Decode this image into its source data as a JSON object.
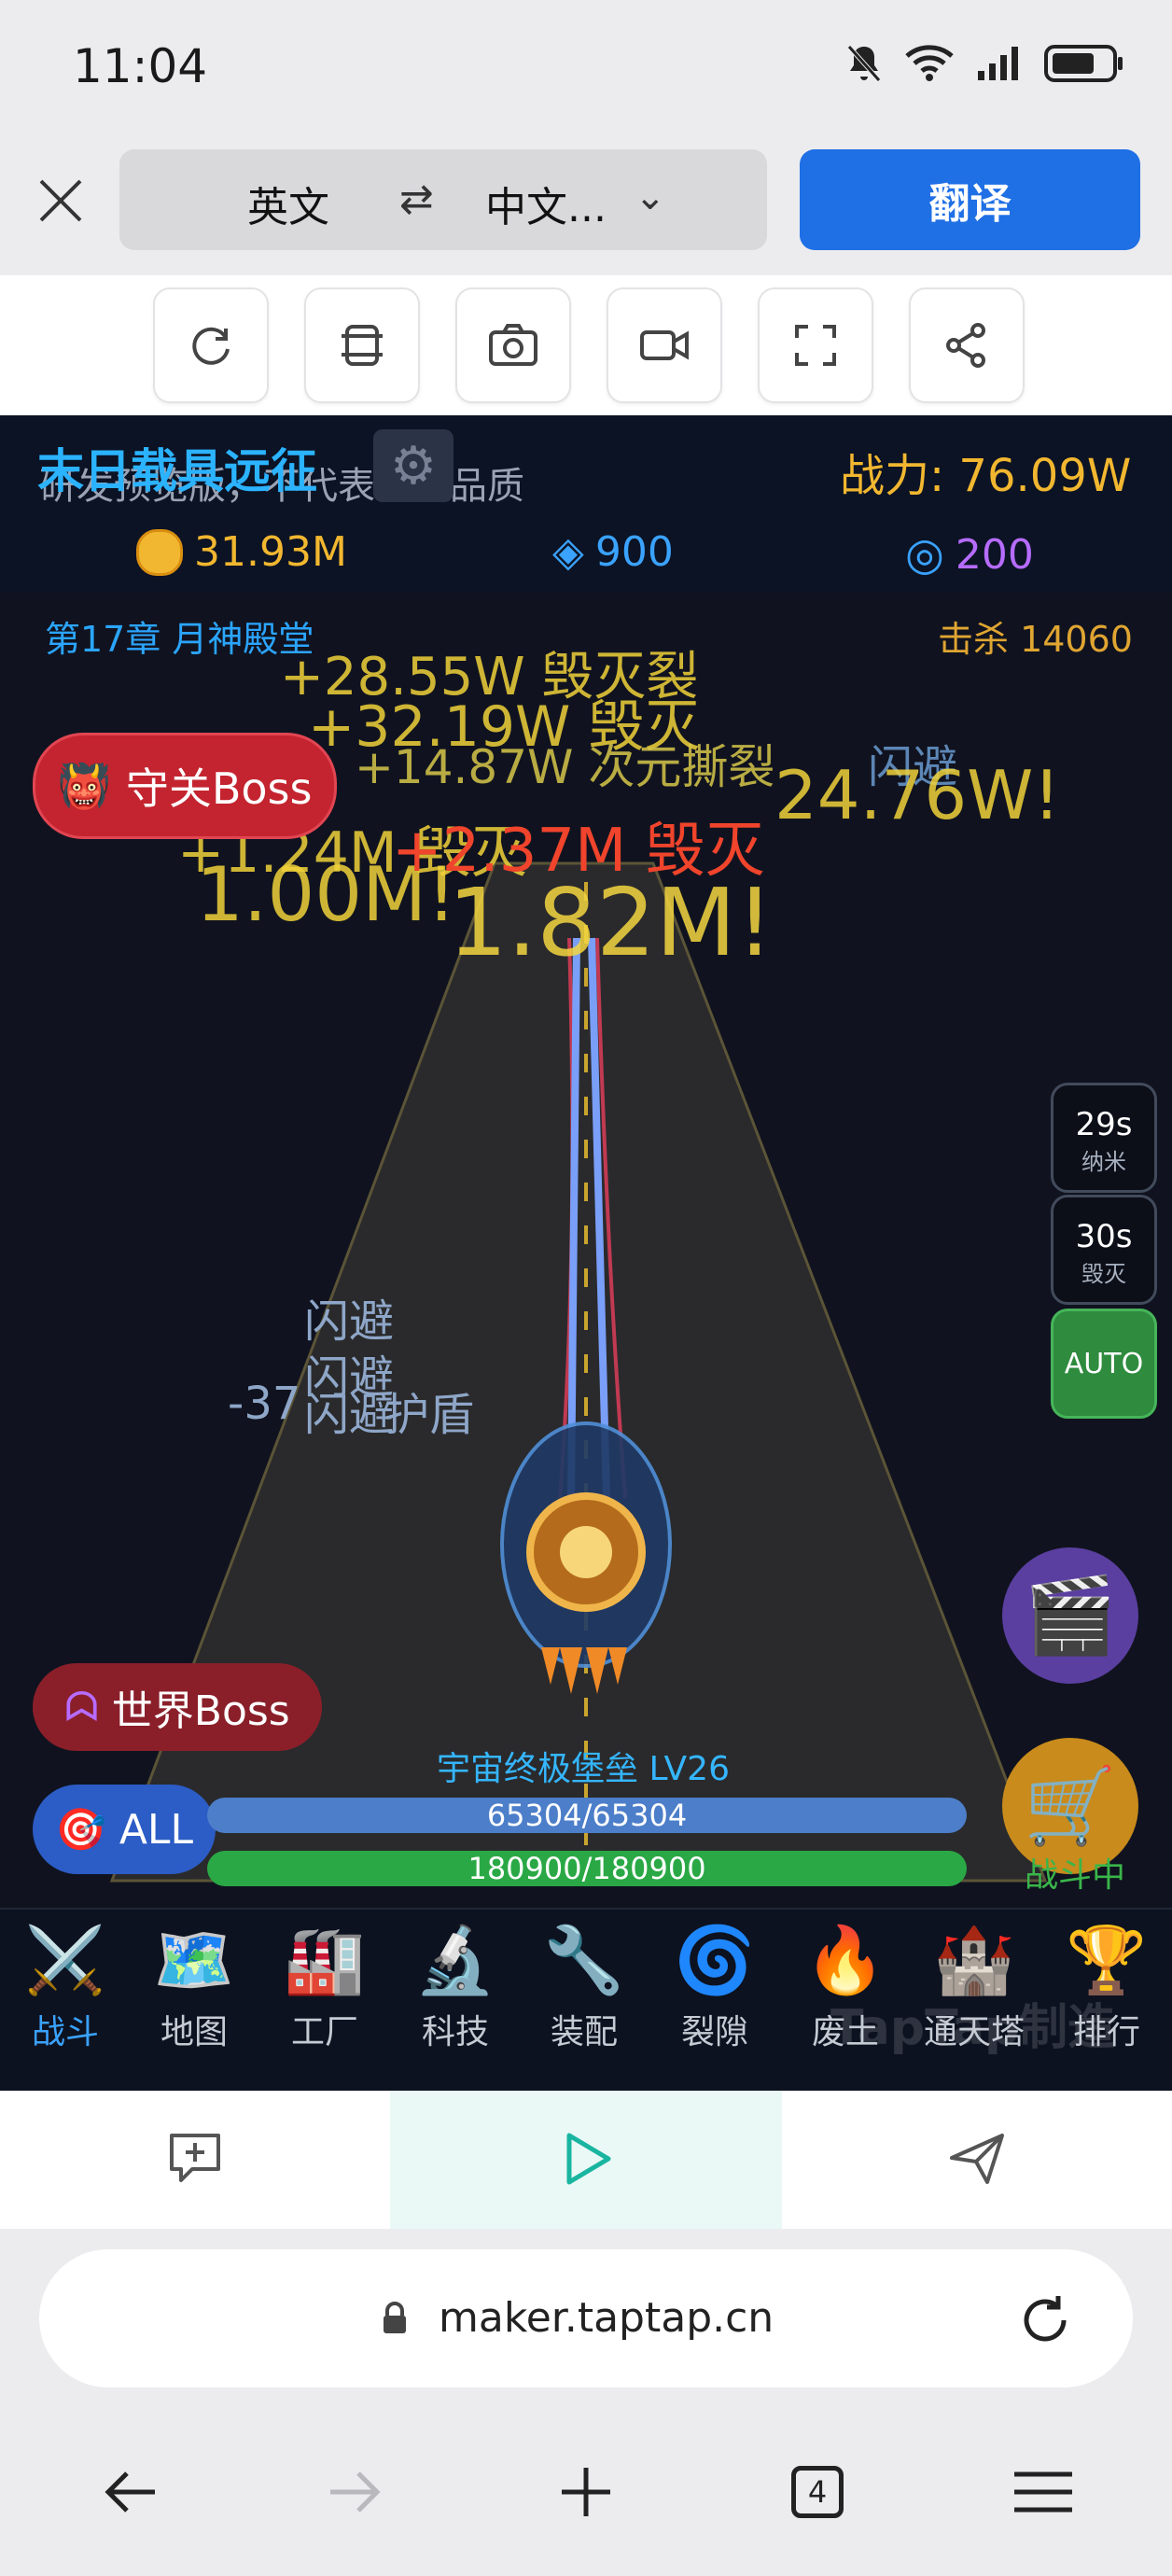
{
  "status": {
    "time": "11:04"
  },
  "translate": {
    "source_lang": "英文",
    "swap_icon": "swap-icon",
    "target_lang": "中文...",
    "chevron": "⌄",
    "button": "翻译"
  },
  "toolbar": {
    "icons": [
      "refresh-icon",
      "layers-icon",
      "camera-icon",
      "video-icon",
      "fullscreen-icon",
      "share-icon"
    ]
  },
  "game": {
    "title": "末日载具远征",
    "dev_note": "研发预览版，不代表最终品质",
    "gear_icon": "⚙",
    "power": "战力: 76.09W",
    "gold": "31.93M",
    "gems": "900",
    "rift": "200",
    "chapter": "第17章 月神殿堂",
    "kills": "击杀 14060",
    "damage_texts": [
      "+28.55W 毁灭裂",
      "+32.19W 毁灭",
      "+14.87W 次元撕裂",
      "闪避",
      "+1.24M 毁灭",
      "1.00M!",
      "1.82M!",
      "24.76W!",
      "+2.37M 毁灭"
    ],
    "dodge_texts": [
      "闪避",
      "闪避",
      "闪避",
      "-37",
      "护盾"
    ],
    "guard_boss": "守关Boss",
    "world_boss": "世界Boss",
    "all_label": "ALL",
    "skills": [
      {
        "time": "29s",
        "name": "纳米"
      },
      {
        "time": "30s",
        "name": "毁灭"
      }
    ],
    "auto": "AUTO",
    "in_battle": "战斗中",
    "ship_name": "宇宙终极堡垒 LV26",
    "shield": "65304/65304",
    "hp": "180900/180900",
    "nav": [
      {
        "icon": "⚔️",
        "label": "战斗"
      },
      {
        "icon": "🗺️",
        "label": "地图"
      },
      {
        "icon": "🏭",
        "label": "工厂"
      },
      {
        "icon": "🔬",
        "label": "科技"
      },
      {
        "icon": "🔧",
        "label": "装配"
      },
      {
        "icon": "🌀",
        "label": "裂隙"
      },
      {
        "icon": "🔥",
        "label": "废土"
      },
      {
        "icon": "🏰",
        "label": "通天塔"
      },
      {
        "icon": "🏆",
        "label": "排行"
      }
    ],
    "watermark": "TapTap制造"
  },
  "browser": {
    "url": "maker.taptap.cn",
    "tab_count": "4"
  }
}
